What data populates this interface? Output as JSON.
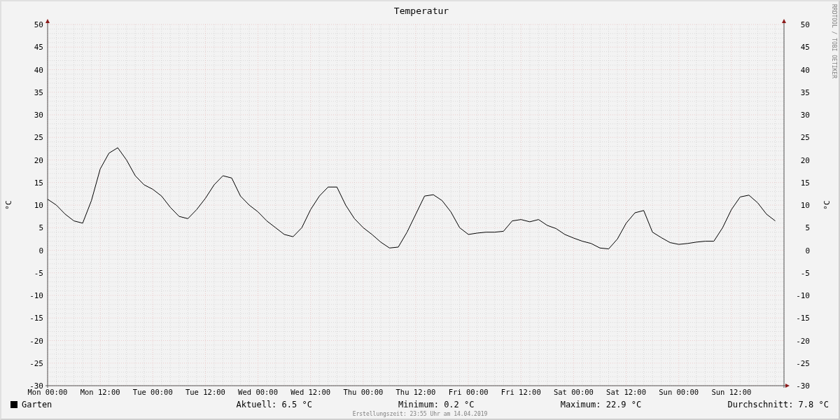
{
  "title": "Temperatur",
  "side_label": "RRDTOOL / TOBI OETIKER",
  "chart_data": {
    "type": "line",
    "ylabel": "°C",
    "ylim": [
      -30,
      50
    ],
    "grid": true,
    "categories": [
      "Mon 00:00",
      null,
      null,
      null,
      null,
      null,
      "Mon 12:00",
      null,
      null,
      null,
      null,
      null,
      "Tue 00:00",
      null,
      null,
      null,
      null,
      null,
      "Tue 12:00",
      null,
      null,
      null,
      null,
      null,
      "Wed 00:00",
      null,
      null,
      null,
      null,
      null,
      "Wed 12:00",
      null,
      null,
      null,
      null,
      null,
      "Thu 00:00",
      null,
      null,
      null,
      null,
      null,
      "Thu 12:00",
      null,
      null,
      null,
      null,
      null,
      "Fri 00:00",
      null,
      null,
      null,
      null,
      null,
      "Fri 12:00",
      null,
      null,
      null,
      null,
      null,
      "Sat 00:00",
      null,
      null,
      null,
      null,
      null,
      "Sat 12:00",
      null,
      null,
      null,
      null,
      null,
      "Sun 00:00",
      null,
      null,
      null,
      null,
      null,
      "Sun 12:00",
      null,
      null,
      null,
      null,
      null
    ],
    "series": [
      {
        "name": "Garten",
        "color": "#000000",
        "values": [
          11.3,
          10,
          8,
          6.5,
          6,
          11,
          18,
          21.5,
          22.7,
          20,
          16.5,
          14.5,
          13.5,
          12,
          9.5,
          7.5,
          7,
          9,
          11.5,
          14.5,
          16.5,
          16,
          12,
          10,
          8.5,
          6.5,
          5,
          3.5,
          3,
          5,
          9,
          12,
          14,
          14,
          10,
          7,
          5,
          3.5,
          1.8,
          0.5,
          0.7,
          4,
          8,
          12,
          12.3,
          11,
          8.5,
          5,
          3.5,
          3.8,
          4,
          4,
          4.2,
          6.5,
          6.8,
          6.3,
          6.8,
          5.5,
          4.8,
          3.5,
          2.7,
          2,
          1.5,
          0.5,
          0.3,
          2.5,
          6,
          8.3,
          8.8,
          4,
          2.8,
          1.7,
          1.3,
          1.5,
          1.8,
          2,
          2,
          5,
          9,
          11.8,
          12.2,
          10.5,
          8,
          6.5
        ]
      }
    ],
    "yticks": [
      50,
      45,
      40,
      35,
      30,
      25,
      20,
      15,
      10,
      5,
      0,
      -5,
      -10,
      -15,
      -20,
      -25,
      -30
    ]
  },
  "right_axis": {
    "ylabel": "°C",
    "ticks": [
      "50",
      "45",
      "40",
      "35",
      "30",
      "25",
      "20",
      "15",
      "10",
      "5",
      "0",
      "-5",
      "-10",
      "-15",
      "-20",
      "-25",
      "-30"
    ]
  },
  "stats": [
    "Aktuell: 6.5 °C",
    "Minimum: 0.2 °C",
    "Maximum: 22.9 °C",
    "Durchschnitt: 7.8 °C"
  ],
  "footer": "Erstellungszeit: 23:55 Uhr am 14.04.2019"
}
